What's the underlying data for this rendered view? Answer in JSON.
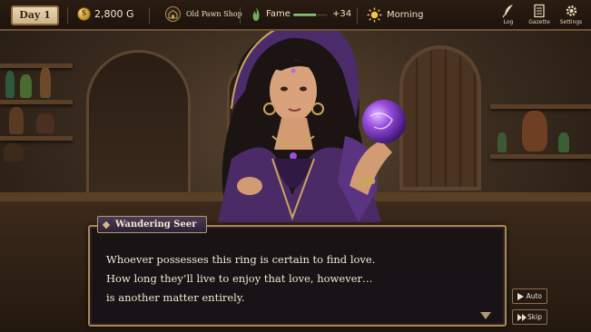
{
  "hud": {
    "day": "Day 1",
    "gold": "2,800 G",
    "location": "Old Pawn Shop",
    "fame_label": "Fame",
    "fame_progress": 0.65,
    "fame_gain": "+34",
    "time_of_day": "Morning"
  },
  "menu": {
    "log": "Log",
    "gazette": "Gazette",
    "settings": "Settings"
  },
  "dialogue": {
    "speaker": "Wandering Seer",
    "lines": [
      "Whoever possesses this ring is certain to find love.",
      "How long they’ll live to enjoy that love, however…",
      "is another matter entirely."
    ]
  },
  "controls": {
    "auto": "Auto",
    "skip": "Skip"
  },
  "colors": {
    "accent_gold": "#a88759",
    "fame_green": "#6fae5a",
    "orb_purple": "#9b4fe0"
  },
  "icons": [
    "gold-coin-icon",
    "shop-icon",
    "flame-icon",
    "sun-icon",
    "quill-icon",
    "newspaper-icon",
    "gear-icon",
    "next-arrow-icon",
    "play-icon",
    "fast-forward-icon"
  ]
}
